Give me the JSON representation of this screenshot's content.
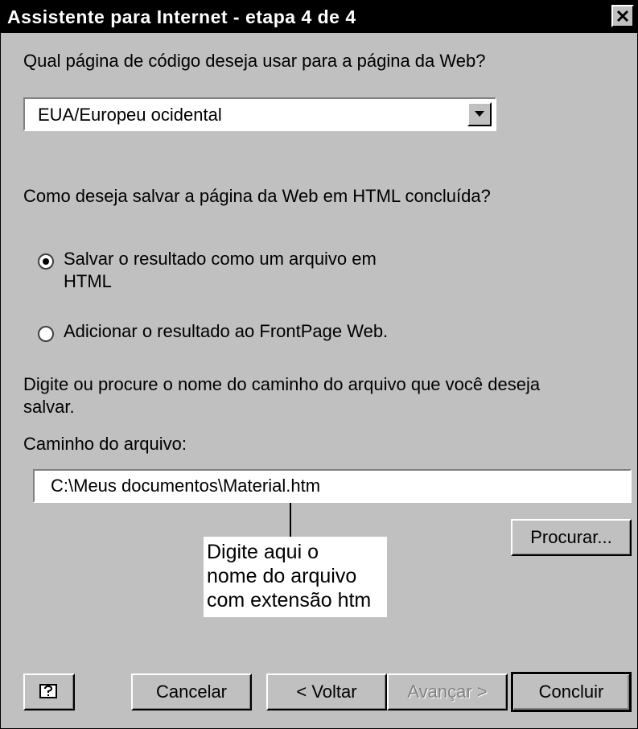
{
  "window": {
    "title": "Assistente para Internet - etapa 4 de 4",
    "close_icon": "close-x-icon"
  },
  "codepage": {
    "question": "Qual página de código deseja usar para a página da Web?",
    "selected": "EUA/Europeu ocidental"
  },
  "save": {
    "question": "Como deseja salvar a página da Web em HTML concluída?",
    "options": [
      {
        "label_line1": "Salvar o resultado como um arquivo em",
        "label_line2": "HTML",
        "selected": true
      },
      {
        "label": "Adicionar o resultado ao FrontPage Web.",
        "selected": false
      }
    ]
  },
  "path": {
    "instruction_line1": "Digite ou procure o nome do caminho do arquivo que você deseja",
    "instruction_line2": "salvar.",
    "label": "Caminho do arquivo:",
    "value": "C:\\Meus documentos\\Material.htm",
    "browse_label": "Procurar..."
  },
  "callout": {
    "line1": "Digite aqui o",
    "line2": "nome do arquivo",
    "line3": "com extensão htm"
  },
  "buttons": {
    "help_icon": "help-icon",
    "cancel": "Cancelar",
    "back": "< Voltar",
    "next": "Avançar >",
    "finish": "Concluir"
  }
}
